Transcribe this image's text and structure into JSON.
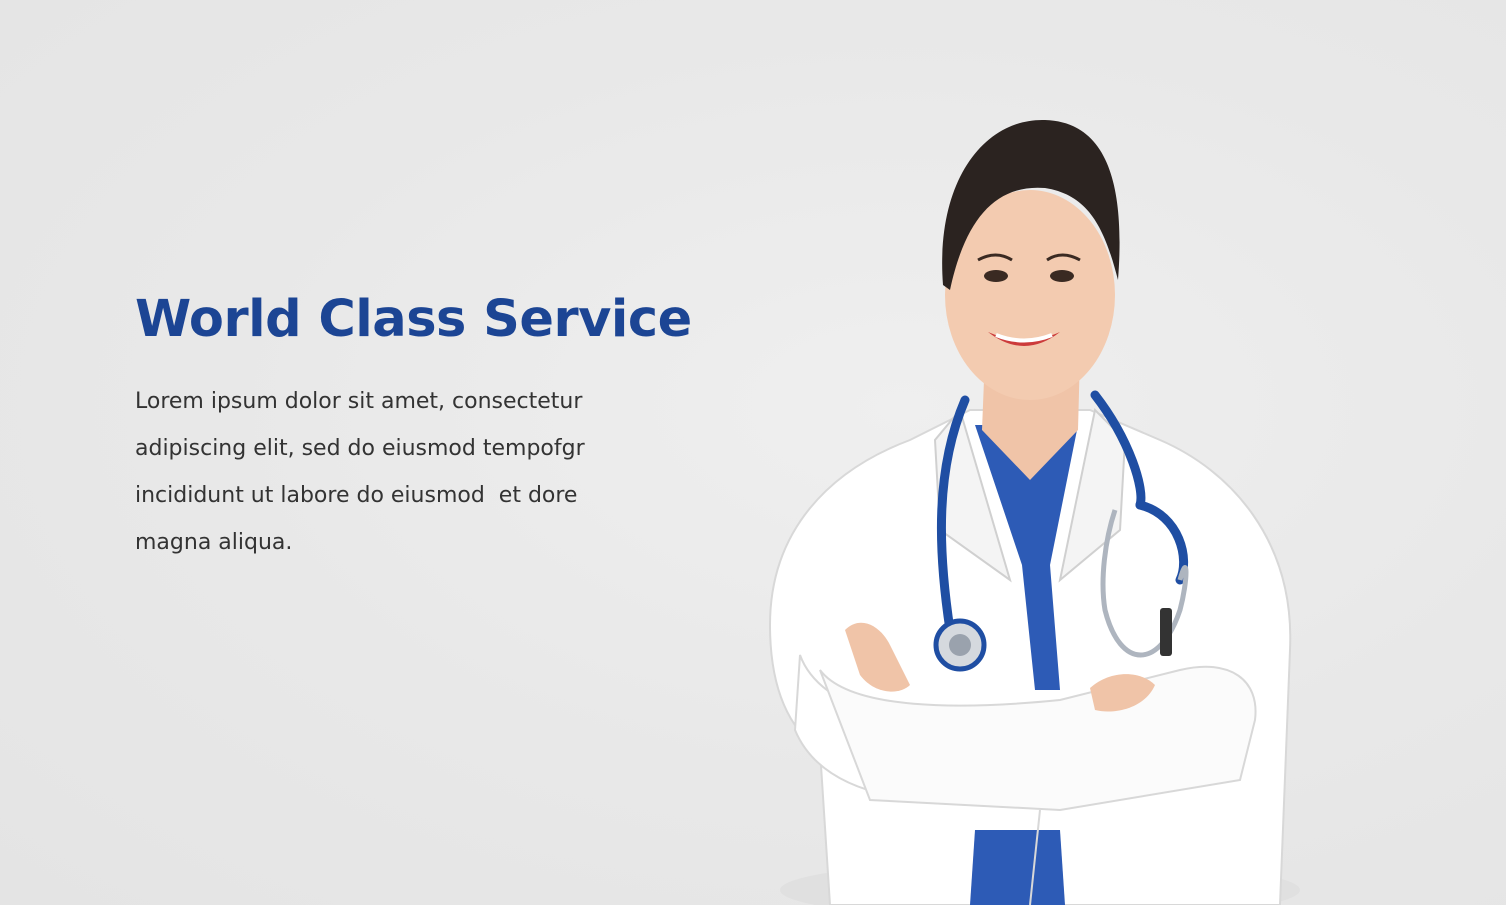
{
  "hero": {
    "headline": "World Class Service",
    "body_lines": [
      "Lorem ipsum dolor sit amet, consectetur",
      "adipiscing elit, sed do eiusmod tempofgr",
      "incididunt ut labore do eiusmod  et dore",
      "magna aliqua."
    ],
    "image_icon": "doctor-photo"
  },
  "colors": {
    "headline": "#1c4594",
    "body_text": "#333333",
    "background": "#e8e8e8",
    "scrubs": "#2d5bb6",
    "coat": "#ffffff"
  }
}
